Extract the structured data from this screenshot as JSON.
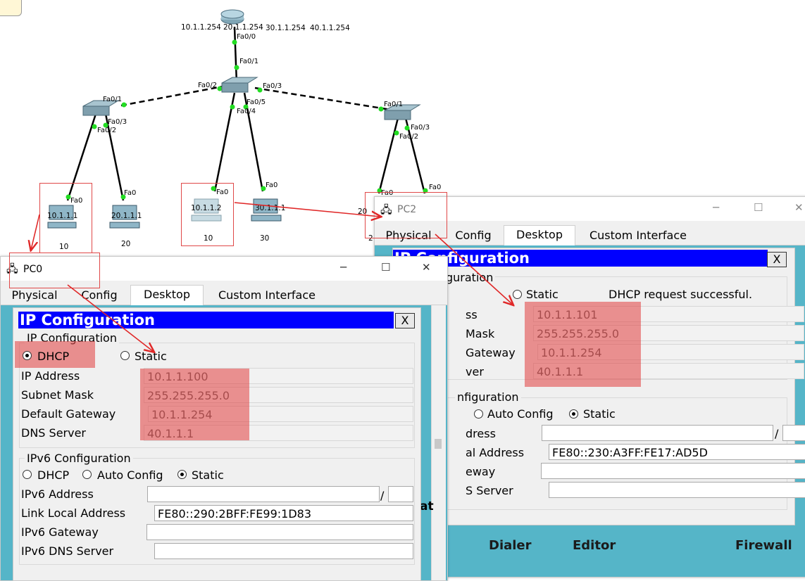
{
  "topology": {
    "router_ips": [
      "10.1.1.254",
      "20.1.1.254",
      "30.1.1.254",
      "40.1.1.254"
    ],
    "port_labels": {
      "router_fa00": "Fa0/0",
      "center_fa01": "Fa0/1",
      "center_fa02": "Fa0/2",
      "center_fa03": "Fa0/3",
      "center_fa05": "Fa0/5",
      "center_fa04": "Fa0/4",
      "left_fa01": "Fa0/1",
      "left_fa03": "Fa0/3",
      "left_fa02": "Fa0/2",
      "right_fa01": "Fa0/1",
      "right_fa03": "Fa0/3",
      "right_fa02": "Fa0/2",
      "pc_fa0": "Fa0"
    },
    "pcs": [
      {
        "ip": "10.1.1.1",
        "vlan": "10"
      },
      {
        "ip": "20.1.1.1",
        "vlan": "20"
      },
      {
        "ip": "10.1.1.2",
        "vlan": "10"
      },
      {
        "ip": "30.1.1.1",
        "vlan": "30"
      },
      {
        "ip": "20",
        "vlan": "2"
      }
    ]
  },
  "pc0": {
    "title": "PC0",
    "tabs": [
      "Physical",
      "Config",
      "Desktop",
      "Custom Interface"
    ],
    "active_tab": "Desktop",
    "ipconfig_title": "IP Configuration",
    "close": "X",
    "ipv4_group": "IP Configuration",
    "dhcp": "DHCP",
    "static": "Static",
    "mode": "DHCP",
    "ip_label": "IP Address",
    "ip": "10.1.1.100",
    "mask_label": "Subnet Mask",
    "mask": "255.255.255.0",
    "gw_label": "Default Gateway",
    "gw": "10.1.1.254",
    "dns_label": "DNS Server",
    "dns": "40.1.1.1",
    "ipv6_group": "IPv6 Configuration",
    "v6_dhcp": "DHCP",
    "v6_auto": "Auto Config",
    "v6_static": "Static",
    "v6_addr_label": "IPv6 Address",
    "v6_addr": "",
    "v6_prefix": "",
    "v6_sep": "/",
    "lla_label": "Link Local Address",
    "lla": "FE80::290:2BFF:FE99:1D83",
    "v6_gw_label": "IPv6 Gateway",
    "v6_gw": "",
    "v6_dns_label": "IPv6 DNS Server",
    "v6_dns": ""
  },
  "pc2": {
    "title": "PC2",
    "tabs": [
      "Physical",
      "Config",
      "Desktop",
      "Custom Interface"
    ],
    "active_tab": "Desktop",
    "ipconfig_title": "IP Configuration",
    "close": "X",
    "group_partial": "guration",
    "static": "Static",
    "status": "DHCP request successful.",
    "ip_label_partial": "ss",
    "ip": "10.1.1.101",
    "mask_label_partial": "Mask",
    "mask": "255.255.255.0",
    "gw_label_partial": "Gateway",
    "gw": "10.1.1.254",
    "dns_label_partial": "ver",
    "dns": "40.1.1.1",
    "ipv6_group_partial": "nfiguration",
    "v6_auto": "Auto Config",
    "v6_static": "Static",
    "v6_addr_label_partial": "dress",
    "v6_sep": "/",
    "lla_label_partial": "al Address",
    "lla": "FE80::230:A3FF:FE17:AD5D",
    "v6_gw_label_partial": "eway",
    "v6_dns_label_partial": "S Server",
    "bottom_items": [
      "Dialer",
      "Editor",
      "Firewall"
    ],
    "edge_glyph": "at",
    "edge_glyph2": "n"
  },
  "colors": {
    "highlight": "#e24646",
    "arrow": "#e02828",
    "title_bar_blue": "#0000ff",
    "desktop_teal": "#55b5c8",
    "link_green": "#22dd22"
  }
}
